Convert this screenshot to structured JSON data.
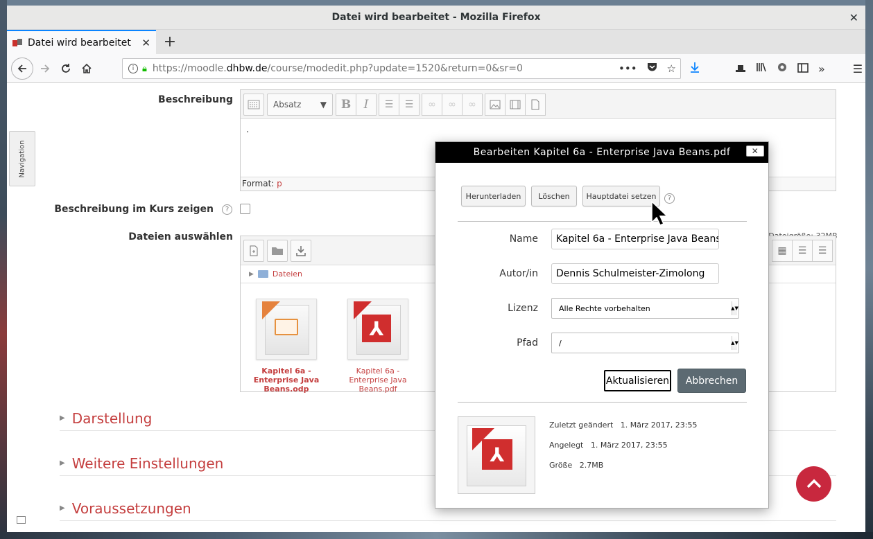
{
  "window": {
    "title": "Datei wird bearbeitet - Mozilla Firefox"
  },
  "tab": {
    "label": "Datei wird bearbeitet"
  },
  "url": {
    "prefix": "https://moodle.",
    "domain": "dhbw.de",
    "path": "/course/modedit.php?update=1520&return=0&sr=0"
  },
  "nav_side": "Navigation",
  "form": {
    "beschreibung_label": "Beschreibung",
    "editor": {
      "format_select": "Absatz",
      "content": ".",
      "format_label": "Format:",
      "format_value": "p"
    },
    "show_in_course_label": "Beschreibung im Kurs zeigen",
    "files_label": "Dateien auswählen",
    "max_size": "e Dateigröße: 32MB",
    "path_folder": "Dateien",
    "files": [
      {
        "name": "Kapitel 6a - Enterprise Java Beans.odp",
        "type": "odp"
      },
      {
        "name": "Kapitel 6a - Enterprise Java Beans.pdf",
        "type": "pdf"
      }
    ],
    "sections": [
      "Darstellung",
      "Weitere Einstellungen",
      "Voraussetzungen"
    ]
  },
  "dialog": {
    "title": "Bearbeiten Kapitel 6a - Enterprise Java Beans.pdf",
    "close": "✕",
    "btn_download": "Herunterladen",
    "btn_delete": "Löschen",
    "btn_main": "Hauptdatei setzen",
    "name_label": "Name",
    "name_value": "Kapitel 6a - Enterprise Java Beans.pdf",
    "author_label": "Autor/in",
    "author_value": "Dennis Schulmeister-Zimolong",
    "license_label": "Lizenz",
    "license_value": "Alle Rechte vorbehalten",
    "path_label": "Pfad",
    "path_value": "/",
    "update_btn": "Aktualisieren",
    "cancel_btn": "Abbrechen",
    "modified_label": "Zuletzt geändert",
    "modified_value": "1. März 2017, 23:55",
    "created_label": "Angelegt",
    "created_value": "1. März 2017, 23:55",
    "size_label": "Größe",
    "size_value": "2.7MB"
  },
  "colors": {
    "accent": "#c43e3e",
    "scroll_top": "#c8283e",
    "cancel_btn": "#5c6a72",
    "tab_highlight": "#0a84ff"
  },
  "icons": [
    "back-icon",
    "forward-icon",
    "reload-icon",
    "home-icon",
    "info-icon",
    "lock-icon",
    "page-actions-icon",
    "pocket-icon",
    "bookmark-star-icon",
    "download-icon",
    "library-icon",
    "sidebar-icon",
    "overflow-icon",
    "menu-icon",
    "help-icon",
    "folder-icon",
    "pdf-icon",
    "odp-icon",
    "chevron-up-icon"
  ]
}
